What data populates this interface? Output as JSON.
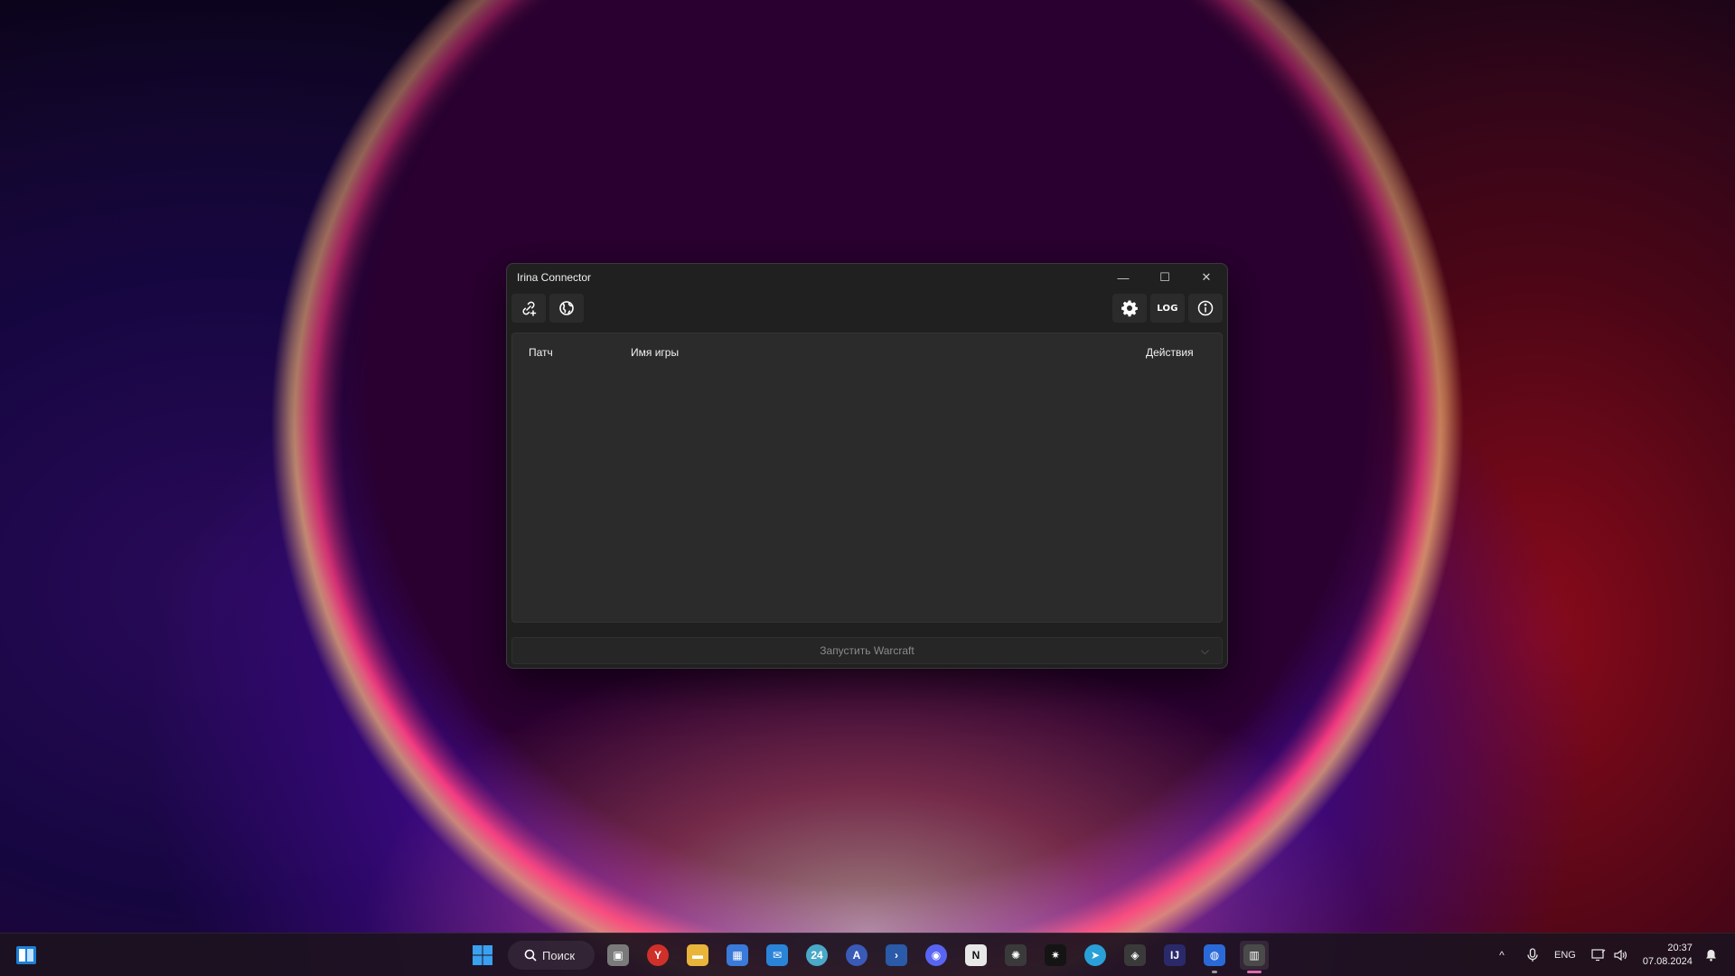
{
  "window": {
    "title": "Irina Connector",
    "controls": {
      "minimize": "—",
      "maximize": "☐",
      "close": "✕"
    },
    "toolbar": {
      "log_label": "LOG"
    },
    "table": {
      "columns": [
        "Патч",
        "Имя игры",
        "Действия"
      ],
      "rows": []
    },
    "launch_button": "Запустить Warcraft"
  },
  "taskbar": {
    "search_label": "Поиск",
    "apps": [
      {
        "name": "task-view",
        "glyph": "▣",
        "color": "#7a7a7a"
      },
      {
        "name": "yandex-browser",
        "glyph": "Y",
        "color": "#d0302a"
      },
      {
        "name": "file-explorer",
        "glyph": "▬",
        "color": "#e8b43a"
      },
      {
        "name": "microsoft-store",
        "glyph": "▦",
        "color": "#3a7ad8"
      },
      {
        "name": "mail",
        "glyph": "✉",
        "color": "#2a84d8"
      },
      {
        "name": "app-24",
        "glyph": "24",
        "color": "#4aa8c8"
      },
      {
        "name": "app-a",
        "glyph": "A",
        "color": "#3a5ab8"
      },
      {
        "name": "powershell",
        "glyph": "›",
        "color": "#2a5aa8"
      },
      {
        "name": "discord",
        "glyph": "◉",
        "color": "#5865f2"
      },
      {
        "name": "notion",
        "glyph": "N",
        "color": "#e8e8e8"
      },
      {
        "name": "chatgpt",
        "glyph": "✺",
        "color": "#3a3a3a"
      },
      {
        "name": "app-star",
        "glyph": "✷",
        "color": "#141414"
      },
      {
        "name": "telegram",
        "glyph": "➤",
        "color": "#2aa0d8"
      },
      {
        "name": "app-shield",
        "glyph": "◈",
        "color": "#3a3a3a"
      },
      {
        "name": "intellij",
        "glyph": "IJ",
        "color": "#2a2a6a"
      },
      {
        "name": "app-globe",
        "glyph": "◍",
        "color": "#2a6ad8"
      },
      {
        "name": "irina-connector",
        "glyph": "▥",
        "color": "#4a4a4a"
      }
    ],
    "tray": {
      "chevron": "^",
      "lang": "ENG",
      "time": "20:37",
      "date": "07.08.2024"
    }
  },
  "colors": {
    "window_bg": "#202020",
    "table_bg": "#2b2b2b",
    "active_indicator": "#e06aa8"
  }
}
